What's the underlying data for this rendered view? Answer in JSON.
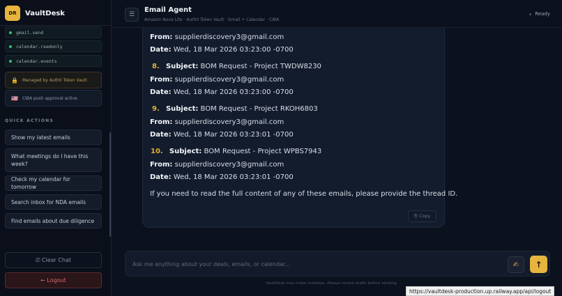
{
  "brand": {
    "initials": "DR",
    "name": "VaultDesk"
  },
  "sidebar": {
    "scopes": [
      "gmail.send",
      "calendar.readonly",
      "calendar.events"
    ],
    "info": [
      {
        "icon": "lock-icon",
        "glyph": "🔒",
        "text": "Managed by Auth0 Token Vault"
      },
      {
        "icon": "flag-icon",
        "glyph": "🇺🇸",
        "text": "CIBA push approval active"
      }
    ],
    "quick_actions_label": "QUICK ACTIONS",
    "quick_actions": [
      "Show my latest emails",
      "What meetings do I have this week?",
      "Check my calendar for tomorrow",
      "Search inbox for NDA emails",
      "Find emails about due diligence"
    ],
    "clear_chat": "⎚ Clear Chat",
    "logout": "← Logout"
  },
  "header": {
    "menu_glyph": "☰",
    "title": "Email Agent",
    "subtitle": "Amazon Nova Lite · Auth0 Token Vault · Gmail + Calendar · CIBA",
    "status": "Ready"
  },
  "message": {
    "from_label": "From:",
    "date_label": "Date:",
    "subject_label": "Subject:",
    "partial": {
      "from": "supplierdiscovery3@gmail.com",
      "date": "Wed, 18 Mar 2026 03:23:00 -0700"
    },
    "emails": [
      {
        "num": "8.",
        "subject": "BOM Request - Project TWDW8230",
        "from": "supplierdiscovery3@gmail.com",
        "date": "Wed, 18 Mar 2026 03:23:00 -0700"
      },
      {
        "num": "9.",
        "subject": "BOM Request - Project RKOH6803",
        "from": "supplierdiscovery3@gmail.com",
        "date": "Wed, 18 Mar 2026 03:23:01 -0700"
      },
      {
        "num": "10.",
        "subject": "BOM Request - Project WPBS7943",
        "from": "supplierdiscovery3@gmail.com",
        "date": "Wed, 18 Mar 2026 03:23:01 -0700"
      }
    ],
    "closing": "If you need to read the full content of any of these emails, please provide the thread ID.",
    "copy_label": "⎘ Copy"
  },
  "composer": {
    "placeholder": "Ask me anything about your deals, emails, or calendar...",
    "hand_glyph": "✍",
    "send_glyph": "↑"
  },
  "disclaimer": "VaultDesk may make mistakes. Always review drafts before sending.",
  "url_tooltip": "https://vaultdesk-production.up.railway.app/api/logout",
  "colors": {
    "accent": "#e7b43e",
    "background": "#0b111d",
    "danger": "#e06a6a",
    "success": "#37c26a"
  }
}
